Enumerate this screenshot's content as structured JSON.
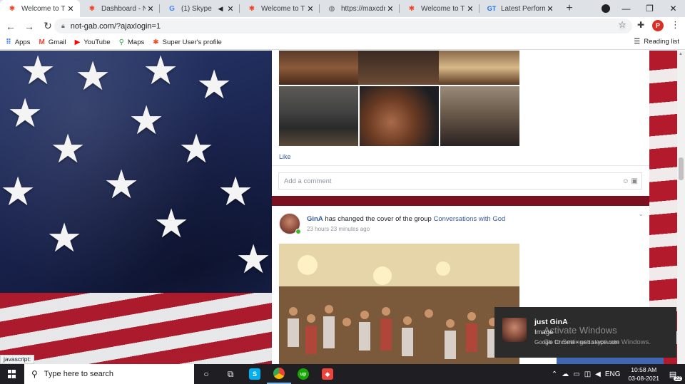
{
  "browser": {
    "tabs": [
      {
        "title": "Welcome to This",
        "favicon": "joomla-icon",
        "active": true
      },
      {
        "title": "Dashboard - Not",
        "favicon": "joomla-icon",
        "active": false
      },
      {
        "title": "(1) Skype",
        "favicon": "google-icon",
        "active": false
      },
      {
        "title": "Welcome to This",
        "favicon": "joomla-icon",
        "active": false
      },
      {
        "title": "https://maxcdn.b",
        "favicon": "globe-icon",
        "active": false
      },
      {
        "title": "Welcome to This",
        "favicon": "joomla-icon",
        "active": false
      },
      {
        "title": "Latest Performan",
        "favicon": "gt-icon",
        "active": false
      }
    ],
    "tab_close": "✕",
    "new_tab": "+",
    "url": "not-gab.com/?ajaxlogin=1",
    "profile_initial": "P",
    "bookmarks": [
      {
        "label": "Apps",
        "icon": "apps-grid-icon"
      },
      {
        "label": "Gmail",
        "icon": "gmail-icon"
      },
      {
        "label": "YouTube",
        "icon": "youtube-icon"
      },
      {
        "label": "Maps",
        "icon": "maps-pin-icon"
      },
      {
        "label": "Super User's profile",
        "icon": "joomla-icon"
      }
    ],
    "reading_list": "Reading list",
    "status_url": "javascript:"
  },
  "feed": {
    "post1": {
      "like": "Like",
      "comment_placeholder": "Add a comment"
    },
    "post2": {
      "author": "GinA",
      "action": " has changed the cover of the group ",
      "group": "Conversations with God",
      "time": "23 hours 23 minutes ago"
    }
  },
  "notification": {
    "title": "just GinA",
    "body": "Image",
    "source": "Google Chrome • web.skype.com"
  },
  "watermark": {
    "line1": "Activate Windows",
    "line2": "Go to Settings to activate Windows."
  },
  "taskbar": {
    "search_placeholder": "Type here to search",
    "language": "ENG",
    "time": "10:58 AM",
    "date": "03-08-2021",
    "notification_count": "22"
  }
}
